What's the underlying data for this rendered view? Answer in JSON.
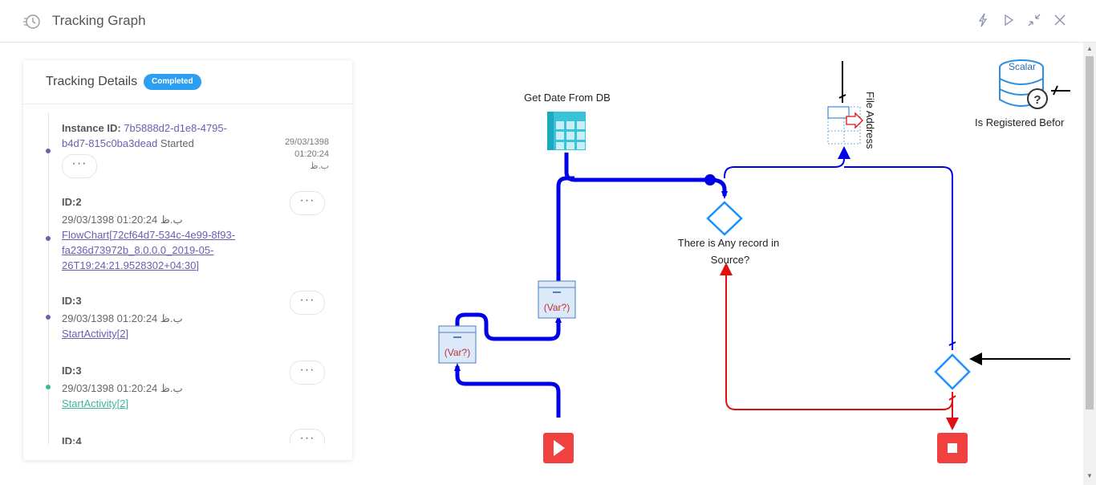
{
  "header": {
    "title": "Tracking Graph"
  },
  "panel": {
    "title": "Tracking Details",
    "status": "Completed",
    "entries": [
      {
        "prefix": "Instance ID: ",
        "instance_id_line1": "7b5888d2-d1e8-4795-",
        "instance_id_line2": "b4d7-815c0ba3dead",
        "suffix": " Started",
        "date": "29/03/1398",
        "time": "01:20:24 ب.ظ",
        "more": "···"
      },
      {
        "id": "ID:2",
        "datetime": "29/03/1398 01:20:24 ب.ظ",
        "link_line1": "FlowChart[72cf64d7-534c-4e99-8f93-",
        "link_line2": "fa236d73972b_8.0.0.0_2019-05-",
        "link_line3": "26T19:24:21.9528302+04:30]",
        "more": "···"
      },
      {
        "id": "ID:3",
        "datetime": "29/03/1398 01:20:24 ب.ظ",
        "link": "StartActivity[2]",
        "more": "···"
      },
      {
        "id": "ID:3",
        "datetime": "29/03/1398 01:20:24 ب.ظ",
        "link": "StartActivity[2]",
        "more": "···"
      },
      {
        "id": "ID:4",
        "more": "···"
      }
    ]
  },
  "graph": {
    "get_date_label": "Get Date From DB",
    "file_address_label": "File Address",
    "decision_label_line1": "There is Any record in",
    "decision_label_line2": "Source?",
    "scalar_text": "Scalar",
    "scalar_label": "Is Registered Befor",
    "var_label": "(Var?)",
    "colors": {
      "main_flow": "#0000e6",
      "red_flow": "#e01010",
      "diamond": "#1e8fff",
      "start": "#f04040"
    }
  }
}
